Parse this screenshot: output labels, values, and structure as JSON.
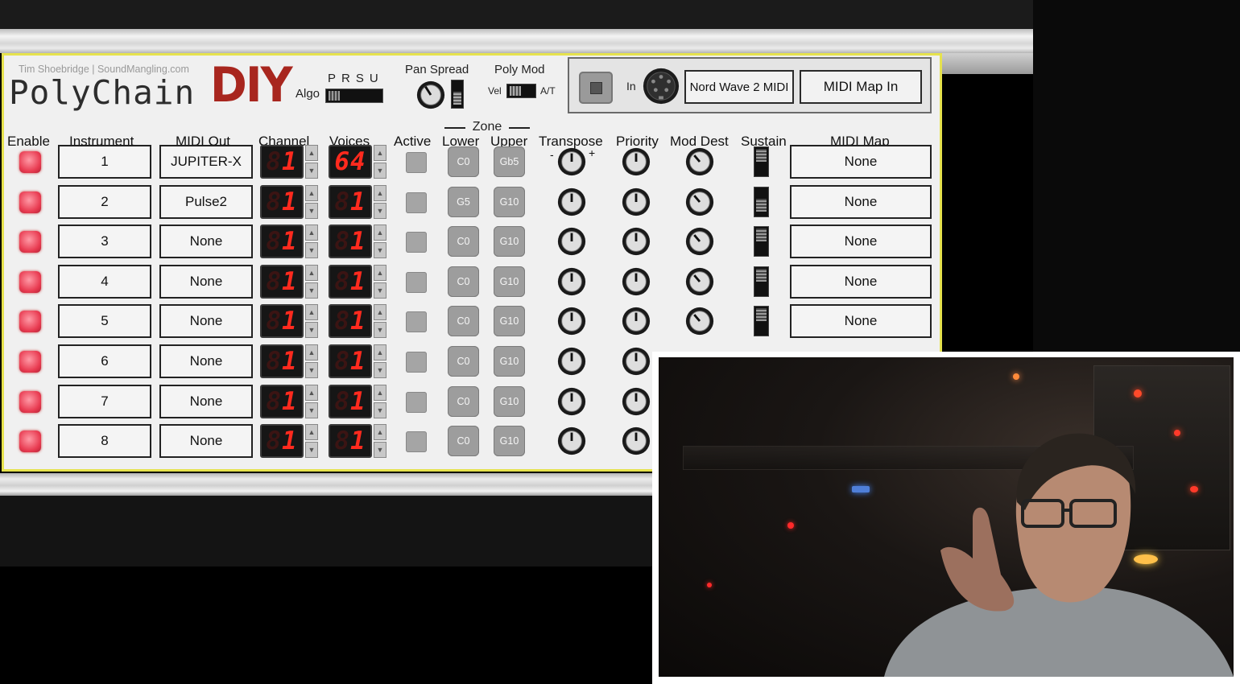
{
  "app": {
    "credit": "Tim Shoebridge | SoundMangling.com",
    "logo_text": "PolyChain",
    "logo_accent": "DIY"
  },
  "top_controls": {
    "algo_letters": "PRSU",
    "algo_label": "Algo",
    "pan_spread_label": "Pan Spread",
    "poly_mod_label": "Poly Mod",
    "vel_label": "Vel",
    "at_label": "A/T",
    "in_label": "In",
    "midi_in_device": "Nord Wave 2 MIDI",
    "midi_map_in_label": "MIDI Map In"
  },
  "headers": {
    "enable": "Enable",
    "instrument": "Instrument",
    "midi_out": "MIDI Out",
    "channel": "Channel",
    "voices": "Voices",
    "active": "Active",
    "zone": "Zone",
    "lower": "Lower",
    "upper": "Upper",
    "transpose": "Transpose",
    "transpose_minus": "-",
    "transpose_plus": "+",
    "priority": "Priority",
    "mod_dest": "Mod Dest",
    "sustain": "Sustain",
    "midi_map": "MIDI Map"
  },
  "rows": [
    {
      "instrument": "1",
      "midi_out": "JUPITER-X",
      "channel": "1",
      "voices": "64",
      "lower": "C0",
      "upper": "Gb5",
      "midi_map": "None"
    },
    {
      "instrument": "2",
      "midi_out": "Pulse2",
      "channel": "1",
      "voices": "1",
      "lower": "G5",
      "upper": "G10",
      "midi_map": "None"
    },
    {
      "instrument": "3",
      "midi_out": "None",
      "channel": "1",
      "voices": "1",
      "lower": "C0",
      "upper": "G10",
      "midi_map": "None"
    },
    {
      "instrument": "4",
      "midi_out": "None",
      "channel": "1",
      "voices": "1",
      "lower": "C0",
      "upper": "G10",
      "midi_map": "None"
    },
    {
      "instrument": "5",
      "midi_out": "None",
      "channel": "1",
      "voices": "1",
      "lower": "C0",
      "upper": "G10",
      "midi_map": "None"
    },
    {
      "instrument": "6",
      "midi_out": "None",
      "channel": "1",
      "voices": "1",
      "lower": "C0",
      "upper": "G10"
    },
    {
      "instrument": "7",
      "midi_out": "None",
      "channel": "1",
      "voices": "1",
      "lower": "C0",
      "upper": "G10"
    },
    {
      "instrument": "8",
      "midi_out": "None",
      "channel": "1",
      "voices": "1",
      "lower": "C0",
      "upper": "G10"
    }
  ],
  "colors": {
    "panel_border": "#e6e24e",
    "logo_accent": "#a8261e",
    "led_on": "#e83a50",
    "seven_segment": "#ff2a1e"
  }
}
